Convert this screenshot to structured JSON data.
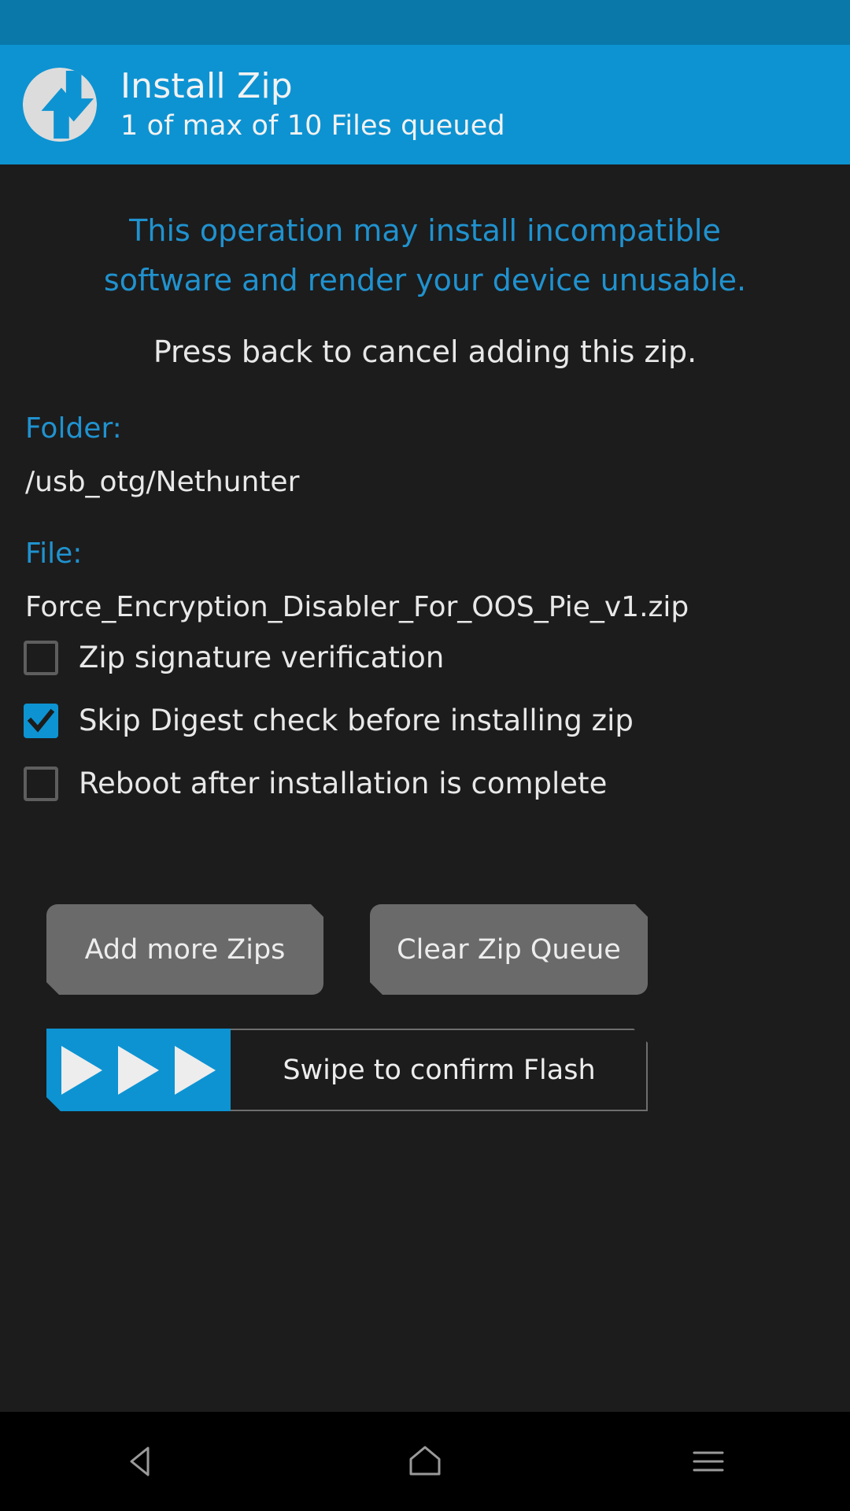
{
  "header": {
    "title": "Install Zip",
    "subtitle": "1 of max of 10 Files queued",
    "logo_icon": "twrp-logo-icon",
    "background_color": "#0d93d2",
    "statusbar_color": "#0a79aa"
  },
  "messages": {
    "warning_line1": "This operation may install incompatible",
    "warning_line2": "software and render your device unusable.",
    "warning_color": "#2092cf",
    "press_back": "Press back to cancel adding this zip."
  },
  "fields": {
    "folder_label": "Folder:",
    "folder_value": "/usb_otg/Nethunter",
    "file_label": "File:",
    "file_value": "Force_Encryption_Disabler_For_OOS_Pie_v1.zip",
    "label_color": "#2092cf"
  },
  "options": [
    {
      "label": "Zip signature verification",
      "checked": false
    },
    {
      "label": "Skip Digest check before installing zip",
      "checked": true
    },
    {
      "label": "Reboot after installation is complete",
      "checked": false
    }
  ],
  "buttons": {
    "add_more": "Add more Zips",
    "clear_queue": "Clear Zip Queue",
    "color": "#6a6a6a"
  },
  "swipe": {
    "label": "Swipe to confirm Flash",
    "fill_color": "#0d93d2",
    "arrow_icon": "play-arrow-icon",
    "arrow_count": 3
  },
  "navbar": {
    "back": "back-icon",
    "home": "home-icon",
    "menu": "menu-icon"
  }
}
